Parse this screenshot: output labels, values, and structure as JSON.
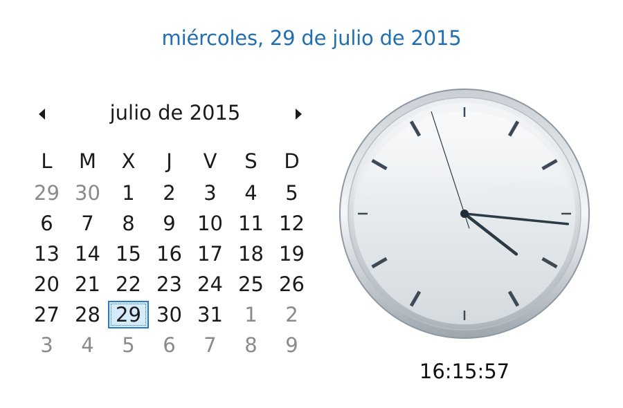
{
  "header": {
    "full_date": "miércoles, 29 de julio de 2015"
  },
  "calendar": {
    "month_title": "julio de 2015",
    "prev_icon": "triangle-left-icon",
    "next_icon": "triangle-right-icon",
    "weekdays": [
      "L",
      "M",
      "X",
      "J",
      "V",
      "S",
      "D"
    ],
    "weeks": [
      [
        {
          "d": "29",
          "o": true
        },
        {
          "d": "30",
          "o": true
        },
        {
          "d": "1"
        },
        {
          "d": "2"
        },
        {
          "d": "3"
        },
        {
          "d": "4"
        },
        {
          "d": "5"
        }
      ],
      [
        {
          "d": "6"
        },
        {
          "d": "7"
        },
        {
          "d": "8"
        },
        {
          "d": "9"
        },
        {
          "d": "10"
        },
        {
          "d": "11"
        },
        {
          "d": "12"
        }
      ],
      [
        {
          "d": "13"
        },
        {
          "d": "14"
        },
        {
          "d": "15"
        },
        {
          "d": "16"
        },
        {
          "d": "17"
        },
        {
          "d": "18"
        },
        {
          "d": "19"
        }
      ],
      [
        {
          "d": "20"
        },
        {
          "d": "21"
        },
        {
          "d": "22"
        },
        {
          "d": "23"
        },
        {
          "d": "24"
        },
        {
          "d": "25"
        },
        {
          "d": "26"
        }
      ],
      [
        {
          "d": "27"
        },
        {
          "d": "28"
        },
        {
          "d": "29",
          "today": true
        },
        {
          "d": "30"
        },
        {
          "d": "31"
        },
        {
          "d": "1",
          "o": true
        },
        {
          "d": "2",
          "o": true
        }
      ],
      [
        {
          "d": "3",
          "o": true
        },
        {
          "d": "4",
          "o": true
        },
        {
          "d": "5",
          "o": true
        },
        {
          "d": "6",
          "o": true
        },
        {
          "d": "7",
          "o": true
        },
        {
          "d": "8",
          "o": true
        },
        {
          "d": "9",
          "o": true
        }
      ]
    ],
    "today_highlight_color": "#2a78c6",
    "other_month_color": "#8a8a8a"
  },
  "clock": {
    "time": "16:15:57",
    "hours": 16,
    "minutes": 15,
    "seconds": 57
  },
  "colors": {
    "accent": "#1f6fb2"
  }
}
